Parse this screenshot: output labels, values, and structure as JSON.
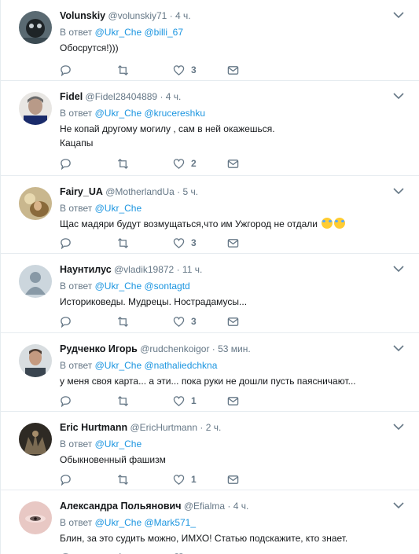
{
  "tweets": [
    {
      "name": "Volunskiy",
      "handle": "@volunskiy71",
      "time": "4 ч.",
      "reply_prefix": "В ответ",
      "mentions": [
        "@Ukr_Che",
        "@billi_67"
      ],
      "text": "Обосрутся!)))",
      "text2": "",
      "likes": "3"
    },
    {
      "name": "Fidel",
      "handle": "@Fidel28404889",
      "time": "4 ч.",
      "reply_prefix": "В ответ",
      "mentions": [
        "@Ukr_Che",
        "@krucereshku"
      ],
      "text": "Не копай другому могилу , сам в ней окажешься.",
      "text2": "Кацапы",
      "likes": "2"
    },
    {
      "name": "Fairy_UA",
      "handle": "@MotherlandUa",
      "time": "5 ч.",
      "reply_prefix": "В ответ",
      "mentions": [
        "@Ukr_Che"
      ],
      "text": "Щас мадяри будут возмущаться,что им Ужгород не отдали",
      "text2": "",
      "likes": "3"
    },
    {
      "name": "Наунтилус",
      "handle": "@vladik19872",
      "time": "11 ч.",
      "reply_prefix": "В ответ",
      "mentions": [
        "@Ukr_Che",
        "@sontagtd"
      ],
      "text": "Историковеды. Мудрецы. Нострадамусы...",
      "text2": "",
      "likes": "3"
    },
    {
      "name": "Рудченко Игорь",
      "handle": "@rudchenkoigor",
      "time": "53 мин.",
      "reply_prefix": "В ответ",
      "mentions": [
        "@Ukr_Che",
        "@nathaliedchkna"
      ],
      "text": "у меня своя карта... а эти... пока руки не дошли пусть паясничают...",
      "text2": "",
      "likes": "1"
    },
    {
      "name": "Eric Hurtmann",
      "handle": "@EricHurtmann",
      "time": "2 ч.",
      "reply_prefix": "В ответ",
      "mentions": [
        "@Ukr_Che"
      ],
      "text": "Обыкновенный фашизм",
      "text2": "",
      "likes": "1"
    },
    {
      "name": "Александра Польянович",
      "handle": "@Efialma",
      "time": "4 ч.",
      "reply_prefix": "В ответ",
      "mentions": [
        "@Ukr_Che",
        "@Mark571_"
      ],
      "text": "Блин, за это судить можно, ИМХО! Статью подскажите, кто знает.",
      "text2": "",
      "likes": ""
    }
  ],
  "colors": {
    "link": "#1b95e0",
    "muted": "#657786",
    "text": "#14171a",
    "divider": "#e6ecf0"
  },
  "icons": [
    "reply-icon",
    "retweet-icon",
    "like-icon",
    "message-icon",
    "chevron-down-icon",
    "grinning-tears-emoji"
  ]
}
